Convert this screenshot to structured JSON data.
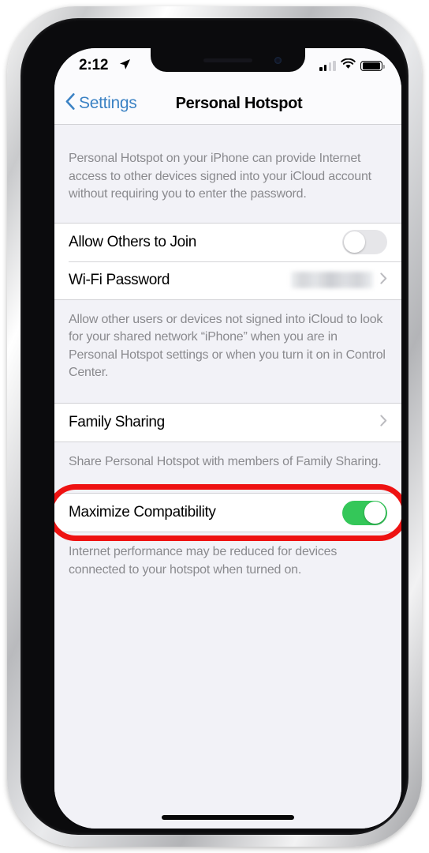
{
  "status_bar": {
    "time": "2:12",
    "location_icon": "location-arrow-icon",
    "signal_icon": "cellular-signal-icon",
    "signal_bars_on": 2,
    "signal_bars_total": 4,
    "wifi_icon": "wifi-icon",
    "battery_icon": "battery-icon",
    "battery_level_percent": 92
  },
  "nav_bar": {
    "back_label": "Settings",
    "back_icon": "chevron-left-icon",
    "title": "Personal Hotspot"
  },
  "sections": {
    "intro_footnote": "Personal Hotspot on your iPhone can provide Internet access to other devices signed into your iCloud account without requiring you to enter the password.",
    "join_group": {
      "allow_others": {
        "label": "Allow Others to Join",
        "toggle_state": "off"
      },
      "wifi_password": {
        "label": "Wi-Fi Password",
        "value": "",
        "value_redacted": true,
        "accessory_icon": "chevron-right-icon"
      }
    },
    "join_footnote": "Allow other users or devices not signed into iCloud to look for your shared network “iPhone” when you are in Personal Hotspot settings or when you turn it on in Control Center.",
    "family_group": {
      "family_sharing": {
        "label": "Family Sharing",
        "accessory_icon": "chevron-right-icon"
      }
    },
    "family_footnote": "Share Personal Hotspot with members of Family Sharing.",
    "compatibility_group": {
      "maximize_compatibility": {
        "label": "Maximize Compatibility",
        "toggle_state": "on",
        "highlighted": true
      }
    },
    "compatibility_footnote": "Internet performance may be reduced for devices connected to your hotspot when turned on."
  },
  "annotation": {
    "type": "oval-highlight",
    "color": "#EE1212",
    "target": "Maximize Compatibility"
  },
  "colors": {
    "accent_blue": "#3B82C4",
    "toggle_on_green": "#34C759",
    "toggle_off_gray": "#E6E6E9",
    "screen_background": "#F2F2F7",
    "row_background": "#FFFFFF",
    "footnote_text": "#8A8A8E",
    "annotation_red": "#EE1212"
  },
  "home_indicator": "home-indicator-bar"
}
